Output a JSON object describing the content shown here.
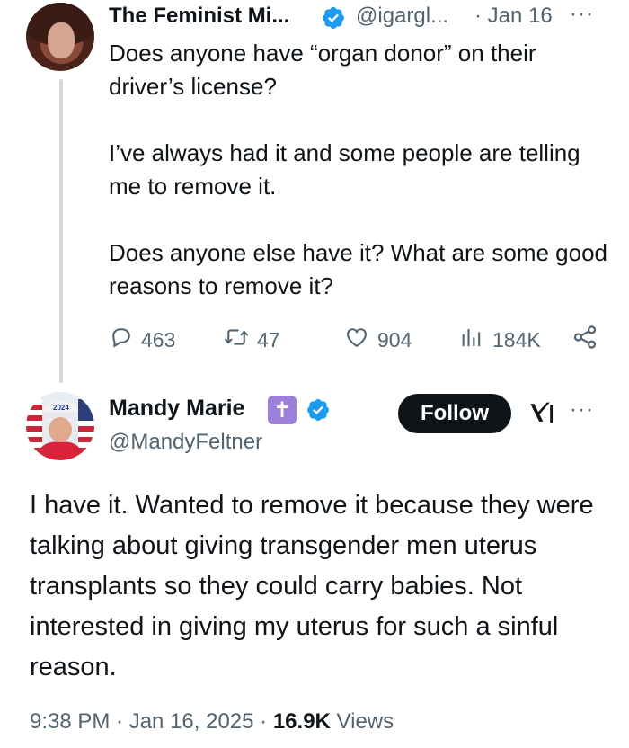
{
  "tweet1": {
    "author_name": "The Feminist Mi...",
    "handle": "@igargl...",
    "date": "· Jan 16",
    "more": "···",
    "paragraphs": [
      "Does anyone have “organ donor” on their driver’s license?",
      "I’ve always had it and some people are telling me to remove it.",
      "Does anyone else have it? What are some good reasons to remove it?"
    ],
    "actions": {
      "replies": "463",
      "reposts": "47",
      "likes": "904",
      "views": "184K"
    }
  },
  "tweet2": {
    "author_name": "Mandy Marie",
    "badge_glyph": "✝",
    "handle": "@MandyFeltner",
    "follow_label": "Follow",
    "more": "···",
    "body": "I have it. Wanted to remove it because they were talking about giving transgender men uterus transplants so they could carry babies. Not interested in giving my uterus for such a sinful reason.",
    "time": "9:38 PM · Jan 16, 2025 · ",
    "views_count": "16.9K",
    "views_label": " Views"
  },
  "colors": {
    "verified": "#1d9bf0",
    "text": "#0f1419",
    "secondary": "#536471",
    "thread_line": "#cfd9de",
    "cross_badge": "#9b7fd9"
  },
  "icons": [
    "reply-icon",
    "repost-icon",
    "like-icon",
    "views-icon",
    "share-icon",
    "verified-icon",
    "grok-icon"
  ]
}
